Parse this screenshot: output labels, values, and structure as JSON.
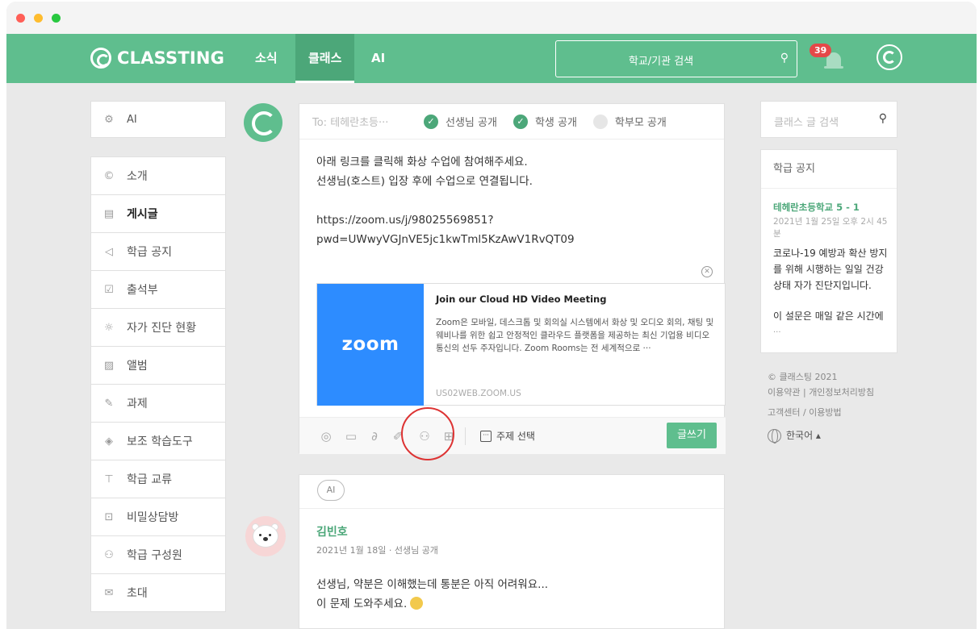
{
  "app": {
    "logo_text": "CLASSTING",
    "tabs": [
      {
        "label": "소식"
      },
      {
        "label": "클래스"
      },
      {
        "label": "AI"
      }
    ],
    "search_placeholder": "학교/기관 검색",
    "notification_count": "39",
    "brand_color": "#5fbe8e"
  },
  "sidebar": {
    "ai_label": "AI",
    "items": [
      {
        "label": "소개",
        "icon": "copyright-icon"
      },
      {
        "label": "게시글",
        "icon": "board-icon"
      },
      {
        "label": "학급 공지",
        "icon": "megaphone-icon"
      },
      {
        "label": "출석부",
        "icon": "attendance-icon"
      },
      {
        "label": "자가 진단 현황",
        "icon": "sun-icon"
      },
      {
        "label": "앨범",
        "icon": "album-icon"
      },
      {
        "label": "과제",
        "icon": "pencil-icon"
      },
      {
        "label": "보조 학습도구",
        "icon": "cube-icon"
      },
      {
        "label": "학급 교류",
        "icon": "exchange-icon"
      },
      {
        "label": "비밀상담방",
        "icon": "secret-chat-icon"
      },
      {
        "label": "학급 구성원",
        "icon": "members-icon"
      },
      {
        "label": "초대",
        "icon": "invite-icon"
      }
    ]
  },
  "compose": {
    "to_label": "To: 테헤란초등···",
    "visibility": [
      {
        "label": "선생님 공개",
        "checked": true
      },
      {
        "label": "학생 공개",
        "checked": true
      },
      {
        "label": "학부모 공개",
        "checked": false
      }
    ],
    "body_lines": [
      "아래 링크를 클릭해 화상 수업에 참여해주세요.",
      "선생님(호스트) 입장 후에 수업으로 연결됩니다.",
      "",
      "https://zoom.us/j/98025569851?",
      "pwd=UWwyVGJnVE5jc1kwTml5KzAwV1RvQT09"
    ],
    "preview": {
      "logo_text": "zoom",
      "title": "Join our Cloud HD Video Meeting",
      "description": "Zoom은 모바일, 데스크톱 및 회의실 시스템에서 화상 및 오디오 회의, 채팅 및 웨비나를 위한 쉽고 안정적인 클라우드 플랫폼을 제공하는 최신 기업용 비디오 통신의 선두 주자입니다. Zoom Rooms는 전 세계적으로 ···",
      "url": "US02WEB.ZOOM.US"
    },
    "topic_label": "주제 선택",
    "write_label": "글쓰기"
  },
  "post": {
    "tag": "AI",
    "author": "김빈호",
    "meta": "2021년 1월 18일 · 선생님 공개",
    "lines": [
      "선생님, 약분은 이해했는데 통분은 아직 어려워요...",
      "이 문제 도와주세요."
    ]
  },
  "right": {
    "search_placeholder": "클래스 글 검색",
    "notice_header": "학급 공지",
    "notice_school": "테헤란초등학교 5 - 1",
    "notice_date": "2021년 1월 25일 오후 2시 45분",
    "notice_body": "코로나-19 예방과 확산 방지를 위해 시행하는 일일 건강 상태 자가 진단지입니다.",
    "notice_body2": "이 설문은 매일 같은 시간에",
    "notice_more": "...",
    "copyright": "© 클래스팅 2021",
    "terms": "이용약관",
    "privacy": "개인정보처리방침",
    "support": "고객센터 / 이용방법",
    "language": "한국어 ▴"
  }
}
